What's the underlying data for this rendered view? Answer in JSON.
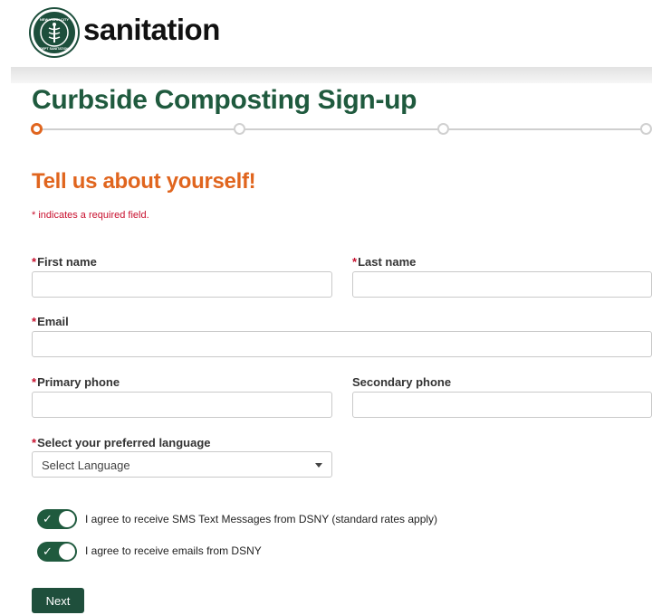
{
  "header": {
    "brand_text": "sanitation",
    "seal_text": "NEW YORK CITY DEPARTMENT OF SANITATION"
  },
  "page": {
    "title": "Curbside Composting Sign-up",
    "steps": [
      {
        "status": "current"
      },
      {
        "status": "upcoming"
      },
      {
        "status": "upcoming"
      },
      {
        "status": "upcoming"
      }
    ]
  },
  "form": {
    "heading": "Tell us about yourself!",
    "required_note": "* indicates a required field.",
    "required_marker": "*",
    "fields": {
      "first_name": {
        "label": "First name",
        "required": true,
        "value": ""
      },
      "last_name": {
        "label": "Last name",
        "required": true,
        "value": ""
      },
      "email": {
        "label": "Email",
        "required": true,
        "value": ""
      },
      "primary_phone": {
        "label": "Primary phone",
        "required": true,
        "value": ""
      },
      "secondary_phone": {
        "label": "Secondary phone",
        "required": false,
        "value": ""
      },
      "language": {
        "label": "Select your preferred language",
        "required": true,
        "selected": "Select Language"
      }
    },
    "consents": {
      "sms": {
        "label": "I agree to receive SMS Text Messages from DSNY (standard rates apply)",
        "checked": true
      },
      "email": {
        "label": "I agree to receive emails from DSNY",
        "checked": true
      }
    },
    "next_label": "Next"
  },
  "colors": {
    "brand_green": "#1f5a3e",
    "accent_orange": "#e0651e",
    "required_red": "#c8102e"
  },
  "icons": {
    "seal": "dsny-seal-icon",
    "check": "check-icon",
    "caret": "caret-down-icon"
  }
}
